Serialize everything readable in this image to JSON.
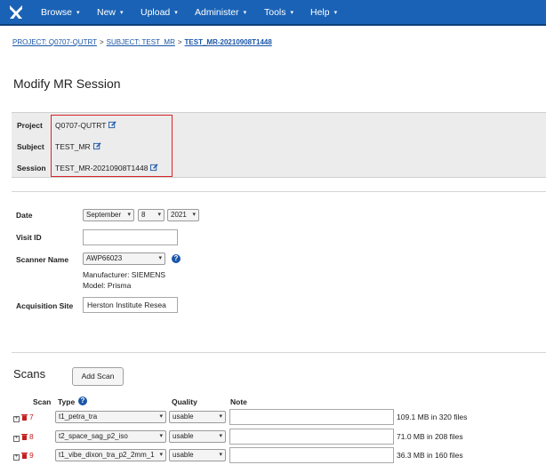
{
  "nav": {
    "items": [
      {
        "label": "Browse"
      },
      {
        "label": "New"
      },
      {
        "label": "Upload"
      },
      {
        "label": "Administer"
      },
      {
        "label": "Tools"
      },
      {
        "label": "Help"
      }
    ]
  },
  "breadcrumb": {
    "project": "PROJECT: Q0707-QUTRT",
    "subject": "SUBJECT: TEST_MR",
    "session": "TEST_MR-20210908T1448",
    "separator": ">"
  },
  "page": {
    "title": "Modify MR Session"
  },
  "identity": {
    "project_label": "Project",
    "project_value": "Q0707-QUTRT",
    "subject_label": "Subject",
    "subject_value": "TEST_MR",
    "session_label": "Session",
    "session_value": "TEST_MR-20210908T1448"
  },
  "form": {
    "date_label": "Date",
    "date_month": "September",
    "date_day": "8",
    "date_year": "2021",
    "visit_label": "Visit ID",
    "visit_value": "",
    "scanner_label": "Scanner Name",
    "scanner_value": "AWP66023",
    "manufacturer": "Manufacturer: SIEMENS",
    "model": "Model: Prisma",
    "site_label": "Acquisition Site",
    "site_value": "Herston Institute Resea"
  },
  "scans": {
    "title": "Scans",
    "add_button": "Add Scan",
    "headers": {
      "scan": "Scan",
      "type": "Type",
      "quality": "Quality",
      "note": "Note"
    },
    "rows": [
      {
        "num": "7",
        "type": "t1_petra_tra",
        "quality": "usable",
        "note": "",
        "size": "109.1 MB in 320 files"
      },
      {
        "num": "8",
        "type": "t2_space_sag_p2_iso",
        "quality": "usable",
        "note": "",
        "size": "71.0 MB in 208 files"
      },
      {
        "num": "9",
        "type": "t1_vibe_dixon_tra_p2_2mm_1",
        "quality": "usable",
        "note": "",
        "size": "36.3 MB in 160 files"
      }
    ]
  },
  "icons": {
    "help": "?",
    "expand": "+",
    "dropdown": "▾"
  },
  "colors": {
    "nav": "#1a62b5",
    "highlight": "#d8232a",
    "link": "#1a56a8"
  }
}
